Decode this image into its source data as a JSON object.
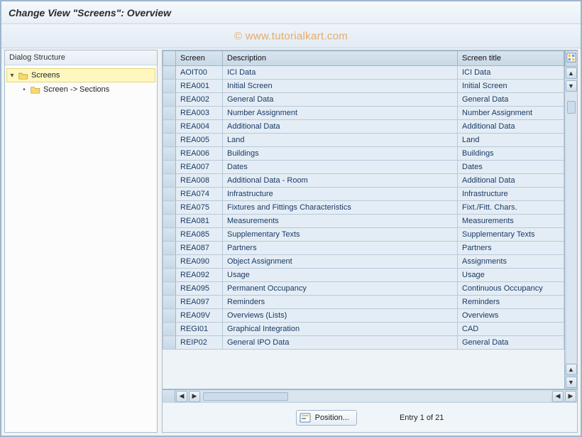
{
  "header": {
    "title": "Change View \"Screens\": Overview"
  },
  "watermark": "© www.tutorialkart.com",
  "tree": {
    "header": "Dialog Structure",
    "nodes": {
      "root": {
        "label": "Screens",
        "expanded": true
      },
      "child": {
        "label": "Screen -> Sections"
      }
    }
  },
  "table": {
    "columns": {
      "screen": "Screen",
      "description": "Description",
      "title": "Screen title"
    },
    "rows": [
      {
        "screen": "AOIT00",
        "description": "ICI Data",
        "title": "ICI Data"
      },
      {
        "screen": "REA001",
        "description": "Initial Screen",
        "title": "Initial Screen"
      },
      {
        "screen": "REA002",
        "description": "General Data",
        "title": "General Data"
      },
      {
        "screen": "REA003",
        "description": "Number Assignment",
        "title": "Number Assignment"
      },
      {
        "screen": "REA004",
        "description": "Additional Data",
        "title": "Additional Data"
      },
      {
        "screen": "REA005",
        "description": "Land",
        "title": "Land"
      },
      {
        "screen": "REA006",
        "description": "Buildings",
        "title": "Buildings"
      },
      {
        "screen": "REA007",
        "description": "Dates",
        "title": "Dates"
      },
      {
        "screen": "REA008",
        "description": "Additional Data - Room",
        "title": "Additional Data"
      },
      {
        "screen": "REA074",
        "description": "Infrastructure",
        "title": "Infrastructure"
      },
      {
        "screen": "REA075",
        "description": "Fixtures and Fittings Characteristics",
        "title": "Fixt./Fitt. Chars."
      },
      {
        "screen": "REA081",
        "description": "Measurements",
        "title": "Measurements"
      },
      {
        "screen": "REA085",
        "description": "Supplementary Texts",
        "title": "Supplementary Texts"
      },
      {
        "screen": "REA087",
        "description": "Partners",
        "title": "Partners"
      },
      {
        "screen": "REA090",
        "description": "Object Assignment",
        "title": "Assignments"
      },
      {
        "screen": "REA092",
        "description": "Usage",
        "title": "Usage"
      },
      {
        "screen": "REA095",
        "description": "Permanent Occupancy",
        "title": "Continuous Occupancy"
      },
      {
        "screen": "REA097",
        "description": "Reminders",
        "title": "Reminders"
      },
      {
        "screen": "REA09V",
        "description": "Overviews (Lists)",
        "title": "Overviews"
      },
      {
        "screen": "REGI01",
        "description": "Graphical Integration",
        "title": "CAD"
      },
      {
        "screen": "REIP02",
        "description": "General IPO Data",
        "title": "General Data"
      }
    ]
  },
  "footer": {
    "position_label": "Position...",
    "entry_text": "Entry 1 of 21"
  }
}
